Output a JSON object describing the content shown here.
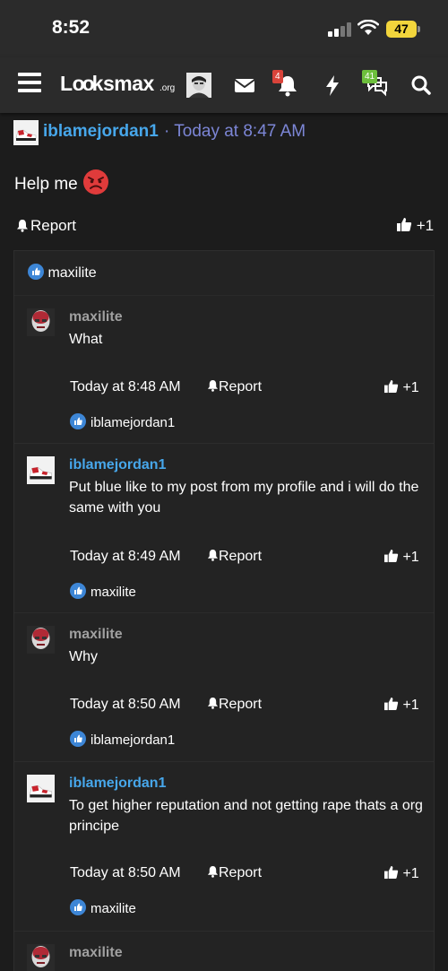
{
  "status_bar": {
    "time": "8:52",
    "battery": "47"
  },
  "navbar": {
    "logo": "Lo oksmax",
    "logo_suffix": ".org",
    "alerts_badge": "4",
    "conversations_badge": "41"
  },
  "thread": {
    "op": {
      "username": "iblamejordan1",
      "separator": "·",
      "time": "Today at 8:47 AM",
      "text": "Help me",
      "report_label": "Report",
      "like_label": "+1",
      "liked_by": "maxilite"
    },
    "comments": [
      {
        "username": "maxilite",
        "text": "What",
        "time": "Today at 8:48 AM",
        "report_label": "Report",
        "like_label": "+1",
        "liked_by": "iblamejordan1"
      },
      {
        "username": "iblamejordan1",
        "text": "Put blue like to my post from my profile and i will do the same with you",
        "time": "Today at 8:49 AM",
        "report_label": "Report",
        "like_label": "+1",
        "liked_by": "maxilite"
      },
      {
        "username": "maxilite",
        "text": "Why",
        "time": "Today at 8:50 AM",
        "report_label": "Report",
        "like_label": "+1",
        "liked_by": "iblamejordan1"
      },
      {
        "username": "iblamejordan1",
        "text": "To get higher reputation and not getting rape thats a org principe",
        "time": "Today at 8:50 AM",
        "report_label": "Report",
        "like_label": "+1",
        "liked_by": "maxilite"
      },
      {
        "username": "maxilite",
        "text": ""
      }
    ]
  },
  "colors": {
    "background": "#1c1c1c",
    "header_bg": "#2b2b2b",
    "link_blue": "#47a7eb",
    "time_purple": "#7c86d6",
    "like_blue": "#3d86d6",
    "badge_red": "#d9433a",
    "badge_green": "#6dbf3c"
  },
  "icons": [
    "hamburger-icon",
    "envelope-icon",
    "bell-icon",
    "lightning-icon",
    "conversations-icon",
    "search-icon",
    "thumbs-up-icon",
    "angry-face-emoji"
  ]
}
